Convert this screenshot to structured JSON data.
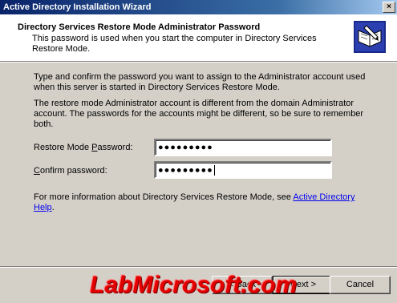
{
  "window": {
    "title": "Active Directory Installation Wizard",
    "close_glyph": "×"
  },
  "header": {
    "title": "Directory Services Restore Mode Administrator Password",
    "subtitle": "This password is used when you start the computer in Directory Services Restore Mode.",
    "icon": "book-pen-icon"
  },
  "body": {
    "para1": "Type and confirm the password you want to assign to the Administrator account used when this server is started in Directory Services Restore Mode.",
    "para2": "The restore mode Administrator account is different from the domain Administrator account. The passwords for the accounts might be different, so be sure to remember both.",
    "restore_label_pre": "Restore Mode ",
    "restore_label_key": "P",
    "restore_label_post": "assword:",
    "restore_value": "●●●●●●●●●",
    "confirm_label_key": "C",
    "confirm_label_post": "onfirm password:",
    "confirm_value": "●●●●●●●●●",
    "help_text": "For more information about Directory Services Restore Mode, see ",
    "help_link": "Active Directory Help",
    "help_end": "."
  },
  "buttons": {
    "back": "< Back",
    "next": "Next >",
    "cancel": "Cancel"
  },
  "watermark": "LabMicrosoft.com"
}
